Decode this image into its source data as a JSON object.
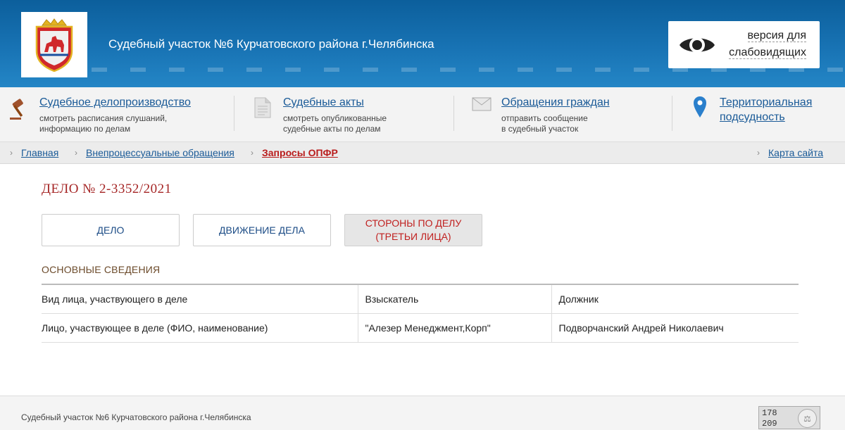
{
  "header": {
    "title": "Судебный участок №6 Курчатовского района г.Челябинска",
    "vision_line1": "версия для",
    "vision_line2": "слабовидящих",
    "accent_color": "#1873b4"
  },
  "nav": [
    {
      "icon": "gavel-icon",
      "title": "Судебное делопроизводство",
      "desc1": "смотреть расписания слушаний,",
      "desc2": "информацию по делам"
    },
    {
      "icon": "document-icon",
      "title": "Судебные акты",
      "desc1": "смотреть опубликованные",
      "desc2": "судебные акты по делам"
    },
    {
      "icon": "envelope-icon",
      "title": "Обращения граждан",
      "desc1": "отправить сообщение",
      "desc2": "в судебный участок"
    },
    {
      "icon": "map-pin-icon",
      "title1": "Территориальная",
      "title2": "подсудность"
    }
  ],
  "breadcrumb": {
    "home": "Главная",
    "section": "Внепроцессуальные обращения",
    "current": "Запросы ОПФР",
    "sitemap": "Карта сайта"
  },
  "case": {
    "title": "ДЕЛО № 2-3352/2021",
    "tabs": {
      "tab1": "ДЕЛО",
      "tab2": "ДВИЖЕНИЕ ДЕЛА",
      "tab3_line1": "СТОРОНЫ ПО ДЕЛУ",
      "tab3_line2": "(ТРЕТЬИ ЛИЦА)"
    },
    "section_title": "ОСНОВНЫЕ СВЕДЕНИЯ",
    "table": {
      "row1": {
        "c1": "Вид лица, участвующего в деле",
        "c2": "Взыскатель",
        "c3": "Должник"
      },
      "row2": {
        "c1": "Лицо, участвующее в деле (ФИО, наименование)",
        "c2": "\"Алезер Менеджмент,Корп\"",
        "c3": "Подворчанский Андрей Николаевич"
      }
    }
  },
  "footer": {
    "text": "Судебный участок №6 Курчатовского района г.Челябинска",
    "counter_top": "178",
    "counter_bottom": "209"
  }
}
